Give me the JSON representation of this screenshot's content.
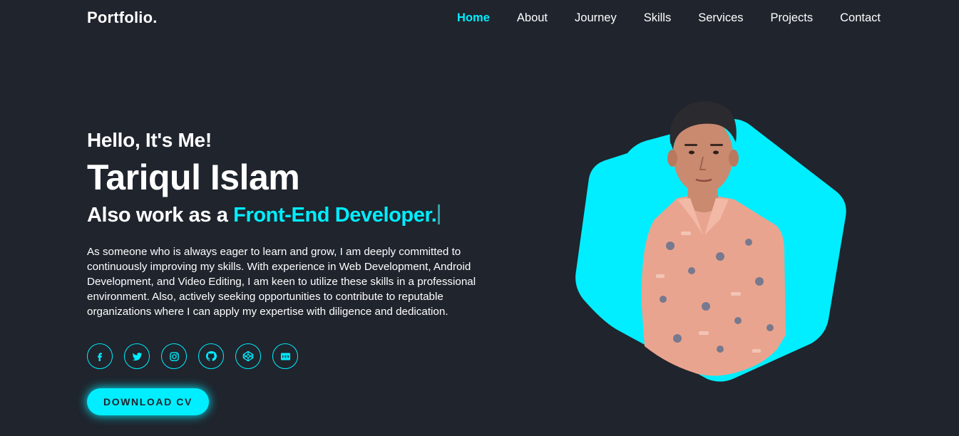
{
  "header": {
    "logo": "Portfolio.",
    "nav": [
      {
        "label": "Home",
        "active": true
      },
      {
        "label": "About",
        "active": false
      },
      {
        "label": "Journey",
        "active": false
      },
      {
        "label": "Skills",
        "active": false
      },
      {
        "label": "Services",
        "active": false
      },
      {
        "label": "Projects",
        "active": false
      },
      {
        "label": "Contact",
        "active": false
      }
    ]
  },
  "hero": {
    "greeting": "Hello, It's Me!",
    "name": "Tariqul Islam",
    "role_prefix": "Also work as a ",
    "role_highlight": "Front-End Developer.",
    "description": "As someone who is always eager to learn and grow, I am deeply committed to continuously improving my skills. With experience in Web Development, Android Development, and Video Editing, I am keen to utilize these skills in a professional environment. Also, actively seeking opportunities to contribute to reputable organizations where I can apply my expertise with diligence and dedication.",
    "cta_label": "DOWNLOAD CV"
  },
  "socials": [
    {
      "icon": "facebook-icon"
    },
    {
      "icon": "twitter-icon"
    },
    {
      "icon": "instagram-icon"
    },
    {
      "icon": "github-icon"
    },
    {
      "icon": "codepen-icon"
    },
    {
      "icon": "dev-icon"
    }
  ],
  "colors": {
    "background": "#1f242d",
    "accent": "#00eeff",
    "text": "#ffffff"
  }
}
